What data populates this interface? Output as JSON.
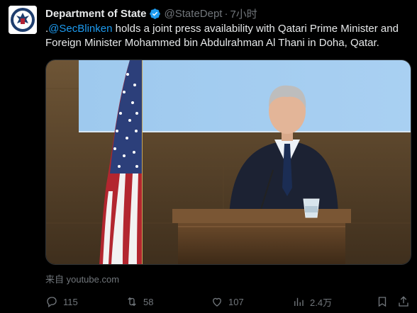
{
  "author": {
    "display_name": "Department of State",
    "handle": "@StateDept",
    "separator": "·",
    "timestamp": "7小时",
    "avatar_icon": "department-of-state-seal",
    "verified_icon": "verified-badge-icon"
  },
  "tweet": {
    "prefix": ".",
    "mention": "@SecBlinken",
    "text": " holds a joint press availability with Qatari Prime Minister and Foreign Minister Mohammed bin Abdulrahman Al Thani in Doha, Qatar."
  },
  "media": {
    "type": "video-thumbnail"
  },
  "source": "来自 youtube.com",
  "actions": {
    "replies": "115",
    "reposts": "58",
    "likes": "107",
    "views": "2.4万"
  },
  "colors": {
    "background": "#000000",
    "text": "#e7e9ea",
    "secondary": "#71767b",
    "link": "#1d9bf0",
    "verified": "#1d9bf0"
  }
}
